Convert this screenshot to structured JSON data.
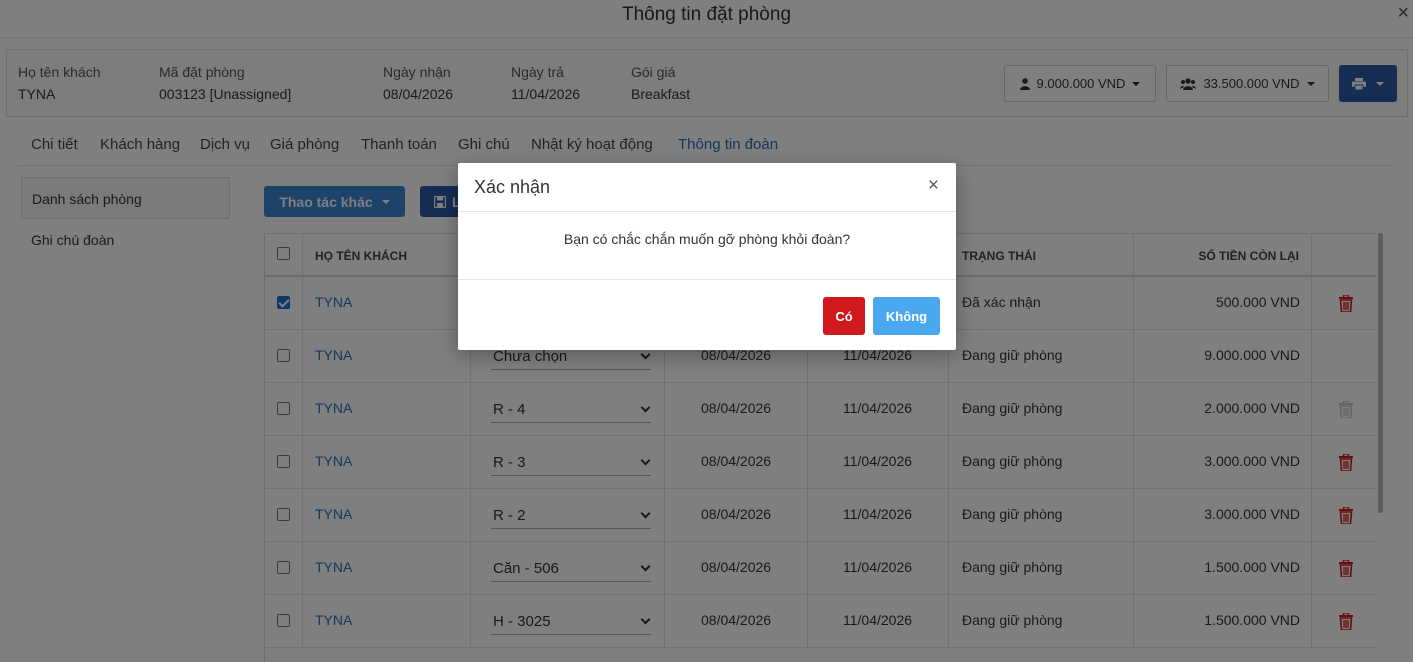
{
  "header": {
    "title": "Thông tin đặt phòng",
    "close": "×"
  },
  "info": {
    "guest_label": "Họ tên khách",
    "guest_value": "TYNA",
    "code_label": "Mã đặt phòng",
    "code_value": "003123 [Unassigned]",
    "checkin_label": "Ngày nhận",
    "checkin_value": "08/04/2026",
    "checkout_label": "Ngày trả",
    "checkout_value": "11/04/2026",
    "rate_label": "Gói giá",
    "rate_value": "Breakfast",
    "amount_single": "9.000.000 VND",
    "amount_group": "33.500.000 VND"
  },
  "tabs": [
    "Chi tiết",
    "Khách hàng",
    "Dịch vụ",
    "Giá phòng",
    "Thanh toán",
    "Ghi chú",
    "Nhật ký hoạt động",
    "Thông tin đoàn"
  ],
  "active_tab": "Thông tin đoàn",
  "sidebar": {
    "room_list": "Danh sách phòng",
    "group_note": "Ghi chú đoàn"
  },
  "toolbar": {
    "more_actions": "Thao tác khác",
    "save_label": "L"
  },
  "table": {
    "headers": {
      "name": "HỌ TÊN KHÁCH",
      "status": "TRẠNG THÁI",
      "balance": "SỐ TIỀN CÒN LẠI"
    },
    "rows": [
      {
        "checked": true,
        "name": "TYNA",
        "room": "",
        "checkin": "",
        "checkout": "",
        "status": "Đã xác nhận",
        "balance": "500.000 VND",
        "delete": "active"
      },
      {
        "checked": false,
        "name": "TYNA",
        "room": "Chưa chọn",
        "checkin": "08/04/2026",
        "checkout": "11/04/2026",
        "status": "Đang giữ phòng",
        "balance": "9.000.000 VND",
        "delete": "none"
      },
      {
        "checked": false,
        "name": "TYNA",
        "room": "R - 4",
        "checkin": "08/04/2026",
        "checkout": "11/04/2026",
        "status": "Đang giữ phòng",
        "balance": "2.000.000 VND",
        "delete": "disabled"
      },
      {
        "checked": false,
        "name": "TYNA",
        "room": "R - 3",
        "checkin": "08/04/2026",
        "checkout": "11/04/2026",
        "status": "Đang giữ phòng",
        "balance": "3.000.000 VND",
        "delete": "active"
      },
      {
        "checked": false,
        "name": "TYNA",
        "room": "R - 2",
        "checkin": "08/04/2026",
        "checkout": "11/04/2026",
        "status": "Đang giữ phòng",
        "balance": "3.000.000 VND",
        "delete": "active"
      },
      {
        "checked": false,
        "name": "TYNA",
        "room": "Căn - 506",
        "checkin": "08/04/2026",
        "checkout": "11/04/2026",
        "status": "Đang giữ phòng",
        "balance": "1.500.000 VND",
        "delete": "active"
      },
      {
        "checked": false,
        "name": "TYNA",
        "room": "H - 3025",
        "checkin": "08/04/2026",
        "checkout": "11/04/2026",
        "status": "Đang giữ phòng",
        "balance": "1.500.000 VND",
        "delete": "active"
      }
    ]
  },
  "dialog": {
    "title": "Xác nhận",
    "close": "×",
    "message": "Bạn có chắc chắn muốn gỡ phòng khỏi đoàn?",
    "yes": "Có",
    "no": "Không"
  },
  "colors": {
    "link": "#2a6ebb",
    "danger": "#d0191c",
    "primary": "#2d5aa6",
    "info": "#4aa8f0"
  }
}
